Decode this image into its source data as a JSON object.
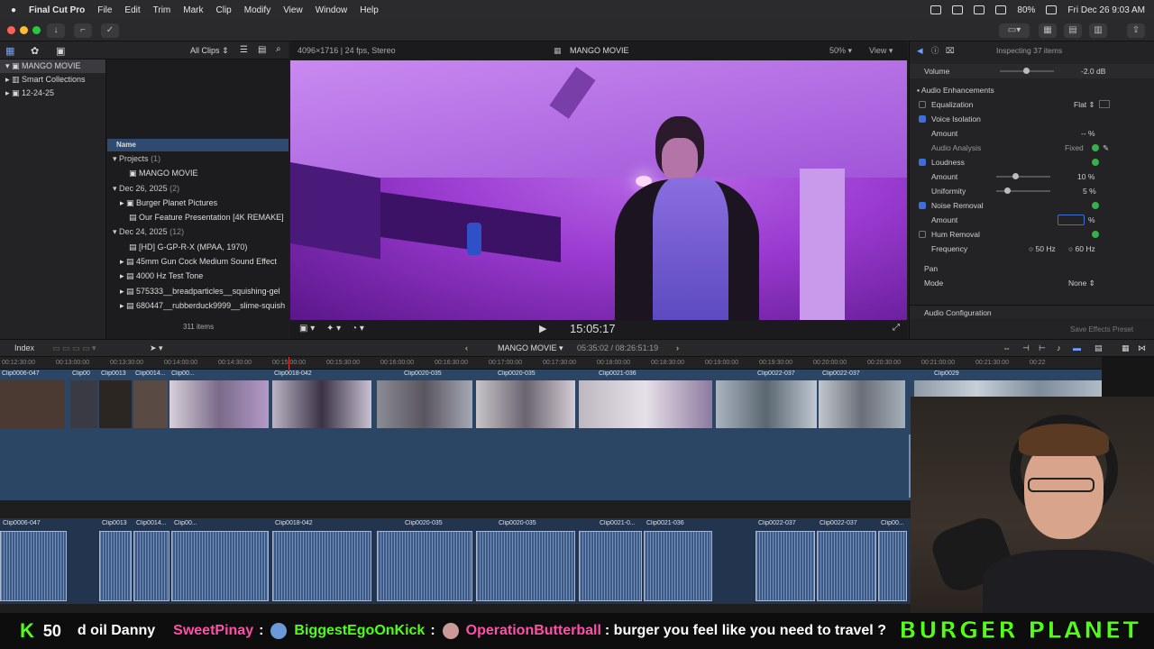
{
  "menubar": {
    "app": "Final Cut Pro",
    "items": [
      "File",
      "Edit",
      "Trim",
      "Mark",
      "Clip",
      "Modify",
      "View",
      "Window",
      "Help"
    ],
    "battery": "80%",
    "datetime": "Fri Dec 26  9:03 AM"
  },
  "browser": {
    "filter": "All Clips",
    "library": [
      {
        "label": "MANGO MOVIE",
        "selected": true
      },
      {
        "label": "Smart Collections",
        "selected": false
      },
      {
        "label": "12-24-25",
        "selected": false
      }
    ],
    "column_header": "Name",
    "rows": [
      {
        "label": "Projects",
        "count": "(1)",
        "group": true
      },
      {
        "label": "MANGO MOVIE",
        "group": false
      },
      {
        "label": "Dec 26, 2025",
        "count": "(2)",
        "group": true
      },
      {
        "label": "Burger Planet Pictures",
        "group": false
      },
      {
        "label": "Our Feature Presentation [4K REMAKE]",
        "group": false
      },
      {
        "label": "Dec 24, 2025",
        "count": "(12)",
        "group": true
      },
      {
        "label": "[HD] G-GP-R-X (MPAA, 1970)",
        "group": false
      },
      {
        "label": "45mm Gun Cock Medium Sound Effect",
        "group": false
      },
      {
        "label": "4000 Hz Test Tone",
        "group": false
      },
      {
        "label": "575333__breadparticles__squishing-gel",
        "group": false
      },
      {
        "label": "680447__rubberduck9999__slime-squish",
        "group": false
      }
    ],
    "item_count": "311 items"
  },
  "viewer": {
    "format": "4096×1716 | 24 fps, Stereo",
    "title": "MANGO MOVIE",
    "zoom": "50%",
    "view_menu": "View",
    "timecode": "15:05:17"
  },
  "inspector": {
    "status": "Inspecting 37 items",
    "volume_label": "Volume",
    "volume_value": "-2.0",
    "volume_unit": "dB",
    "enhancements_label": "Audio Enhancements",
    "equalization": {
      "label": "Equalization",
      "value": "Flat",
      "checked": false
    },
    "voice_isolation": {
      "label": "Voice Isolation",
      "checked": true
    },
    "vi_amount": {
      "label": "Amount",
      "value": "--",
      "unit": "%"
    },
    "audio_analysis": {
      "label": "Audio Analysis",
      "value": "Fixed"
    },
    "loudness": {
      "label": "Loudness",
      "checked": true
    },
    "loud_amount": {
      "label": "Amount",
      "value": "10",
      "unit": "%",
      "level": 0.1
    },
    "loud_uniformity": {
      "label": "Uniformity",
      "value": "5",
      "unit": "%",
      "level": 0.05
    },
    "noise_removal": {
      "label": "Noise Removal",
      "checked": true
    },
    "nr_amount": {
      "label": "Amount",
      "value": "",
      "unit": "%"
    },
    "hum_removal": {
      "label": "Hum Removal",
      "checked": false
    },
    "frequency": {
      "label": "Frequency",
      "opt1": "50 Hz",
      "opt2": "60 Hz"
    },
    "pan_label": "Pan",
    "mode": {
      "label": "Mode",
      "value": "None"
    },
    "audio_config": "Audio Configuration",
    "save_preset": "Save Effects Preset"
  },
  "timeline": {
    "index": "Index",
    "project": "MANGO MOVIE",
    "duration": "05:35:02 / 08:26:51:19",
    "ruler": [
      "00:12:30:00",
      "00:13:00:00",
      "00:13:30:00",
      "00:14:00:00",
      "00:14:30:00",
      "00:15:00:00",
      "00:15:30:00",
      "00:16:00:00",
      "00:16:30:00",
      "00:17:00:00",
      "00:17:30:00",
      "00:18:00:00",
      "00:18:30:00",
      "00:19:00:00",
      "00:19:30:00",
      "00:20:00:00",
      "00:20:30:00",
      "00:21:00:00",
      "00:21:30:00",
      "00:22"
    ],
    "video_clips": [
      {
        "label": "Clip0006-047"
      },
      {
        "label": "Clip00"
      },
      {
        "label": "Clip0013"
      },
      {
        "label": "Clip0014..."
      },
      {
        "label": "Clip00..."
      },
      {
        "label": "Clip0018-042"
      },
      {
        "label": "Clip0020-035"
      },
      {
        "label": "Clip0020-035"
      },
      {
        "label": "Clip0021-036"
      },
      {
        "label": "Clip0022-037"
      },
      {
        "label": "Clip0022-037"
      },
      {
        "label": "Clip0029"
      }
    ],
    "audio_clips": [
      {
        "label": "Clip0006-047"
      },
      {
        "label": "Clip0013"
      },
      {
        "label": "Clip0014..."
      },
      {
        "label": "Clip00..."
      },
      {
        "label": "Clip0018-042"
      },
      {
        "label": "Clip0020-035"
      },
      {
        "label": "Clip0020-035"
      },
      {
        "label": "Clip0021-0..."
      },
      {
        "label": "Clip0021-036"
      },
      {
        "label": "Clip0022-037"
      },
      {
        "label": "Clip0022-037"
      },
      {
        "label": "Clip00..."
      }
    ]
  },
  "ticker": {
    "platform_count": "50",
    "fragment": "d oil Danny",
    "user1": "SweetPinay",
    "colon1": ":",
    "user2": "BiggestEgoOnKick",
    "colon2": ":",
    "user3": "OperationButterball",
    "message": ": burger you feel like you need to travel ?",
    "brand": "BURGER PLANET"
  },
  "colors": {
    "accent": "#3c6fd8",
    "kick_green": "#53fc18",
    "video_purple": "#9a3ad0"
  }
}
